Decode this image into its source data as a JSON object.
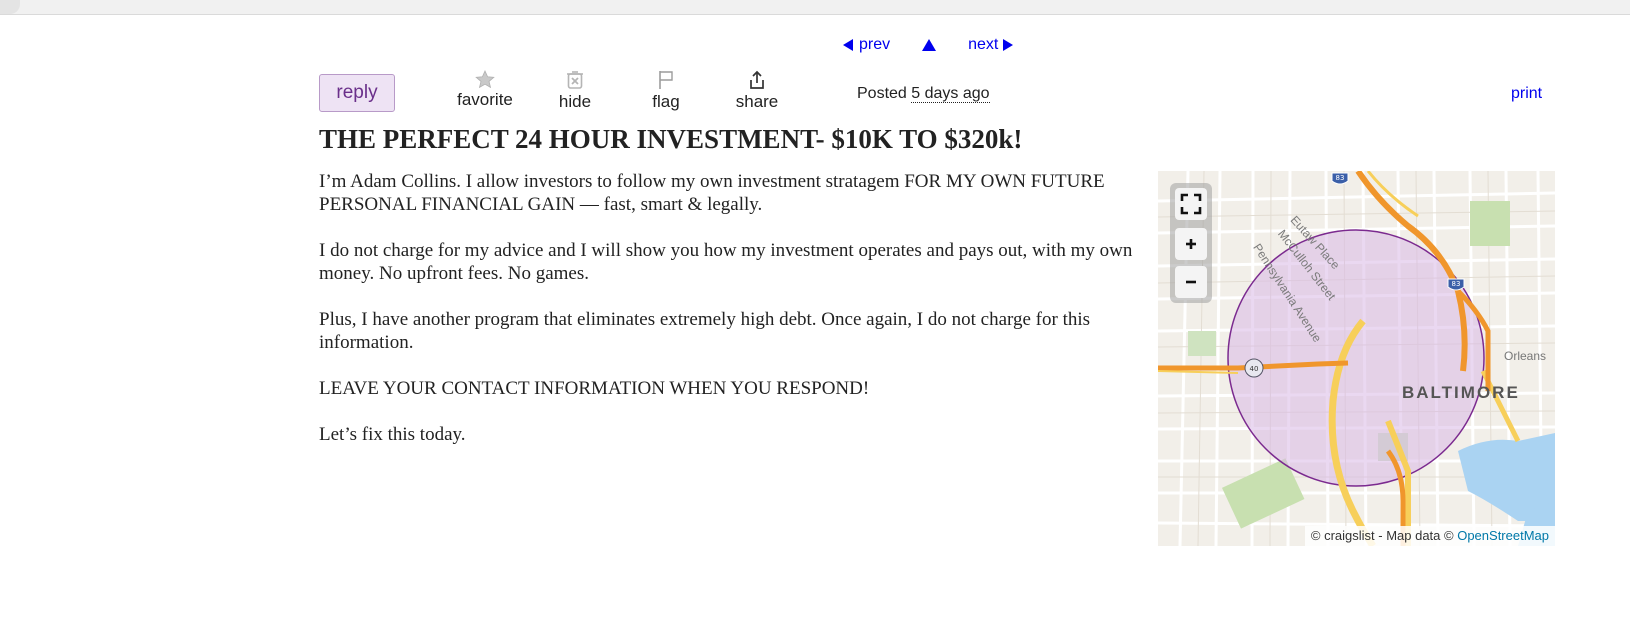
{
  "nav": {
    "prev_label": "prev",
    "next_label": "next"
  },
  "actions": {
    "reply_label": "reply",
    "favorite_label": "favorite",
    "hide_label": "hide",
    "flag_label": "flag",
    "share_label": "share",
    "posted_prefix": "Posted",
    "posted_time": "5 days ago",
    "print_label": "print"
  },
  "post": {
    "title": "THE PERFECT 24 HOUR INVESTMENT- $10K TO $320k!",
    "paragraphs": [
      "I’m Adam Collins. I allow investors to follow my own investment stratagem FOR MY OWN FUTURE PERSONAL FINANCIAL GAIN — fast, smart & legally.",
      "I do not charge for my advice and I will show you how my investment operates and pays out, with my own money. No upfront fees. No games.",
      "Plus, I have another program that eliminates extremely high debt. Once again, I do not charge for this information.",
      "LEAVE YOUR CONTACT INFORMATION WHEN YOU RESPOND!",
      "Let’s fix this today."
    ]
  },
  "map": {
    "city_label": "BALTIMORE",
    "area_label": "Orleans",
    "streets": [
      "Eutaw Place",
      "McCulloh Street",
      "Pennsylvania Avenue"
    ],
    "highway_shields": [
      "83",
      "83",
      "40"
    ],
    "attribution_prefix": "© craigslist - Map data ©",
    "attribution_link": "OpenStreetMap",
    "colors": {
      "radius_circle": "#7b2a8f",
      "radius_fill": "#d8b8e6",
      "highway": "#f0962c",
      "major_road": "#f7cf5a",
      "water": "#aad3f2",
      "park": "#c8e0b0"
    }
  }
}
